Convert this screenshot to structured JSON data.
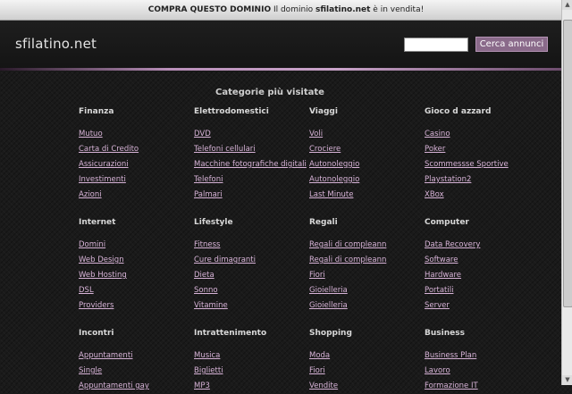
{
  "topbar": {
    "buy": "COMPRA QUESTO DOMINIO",
    "pre": " Il dominio ",
    "domain": "sfilatino.net",
    "post": " è in vendita!"
  },
  "header": {
    "logo": "sfilatino.net",
    "search_button": "Cerca annunci",
    "search_value": ""
  },
  "main_title": "Categorie più visitate",
  "categories": [
    {
      "title": "Finanza",
      "links": [
        "Mutuo",
        "Carta di Credito",
        "Assicurazioni",
        "Investimenti",
        "Azioni"
      ]
    },
    {
      "title": "Elettrodomestici",
      "links": [
        "DVD",
        "Telefoni cellulari",
        "Macchine fotografiche digitali",
        "Telefoni",
        "Palmari"
      ]
    },
    {
      "title": "Viaggi",
      "links": [
        "Voli",
        "Crociere",
        "Autonoleggio",
        "Autonoleggio",
        "Last Minute"
      ]
    },
    {
      "title": "Gioco d azzard",
      "links": [
        "Casino",
        "Poker",
        "Scommessse Sportive",
        "Playstation2",
        "XBox"
      ]
    },
    {
      "title": "Internet",
      "links": [
        "Domini",
        "Web Design",
        "Web Hosting",
        "DSL",
        "Providers"
      ]
    },
    {
      "title": "Lifestyle",
      "links": [
        "Fitness",
        "Cure dimagranti",
        "Dieta",
        "Sonno",
        "Vitamine"
      ]
    },
    {
      "title": "Regali",
      "links": [
        "Regali di compleann",
        "Regali di compleann",
        "Fiori",
        "Gioielleria",
        "Gioielleria"
      ]
    },
    {
      "title": "Computer",
      "links": [
        "Data Recovery",
        "Software",
        "Hardware",
        "Portatili",
        "Server"
      ]
    },
    {
      "title": "Incontri",
      "links": [
        "Appuntamenti",
        "Single",
        "Appuntamenti gay"
      ]
    },
    {
      "title": "Intrattenimento",
      "links": [
        "Musica",
        "Biglietti",
        "MP3"
      ]
    },
    {
      "title": "Shopping",
      "links": [
        "Moda",
        "Fiori",
        "Vendite"
      ]
    },
    {
      "title": "Business",
      "links": [
        "Business Plan",
        "Lavoro",
        "Formazione IT"
      ]
    }
  ],
  "colors": {
    "link": "#d7b3d7",
    "accent": "#8a6a8a",
    "background": "#1a1a1a"
  }
}
